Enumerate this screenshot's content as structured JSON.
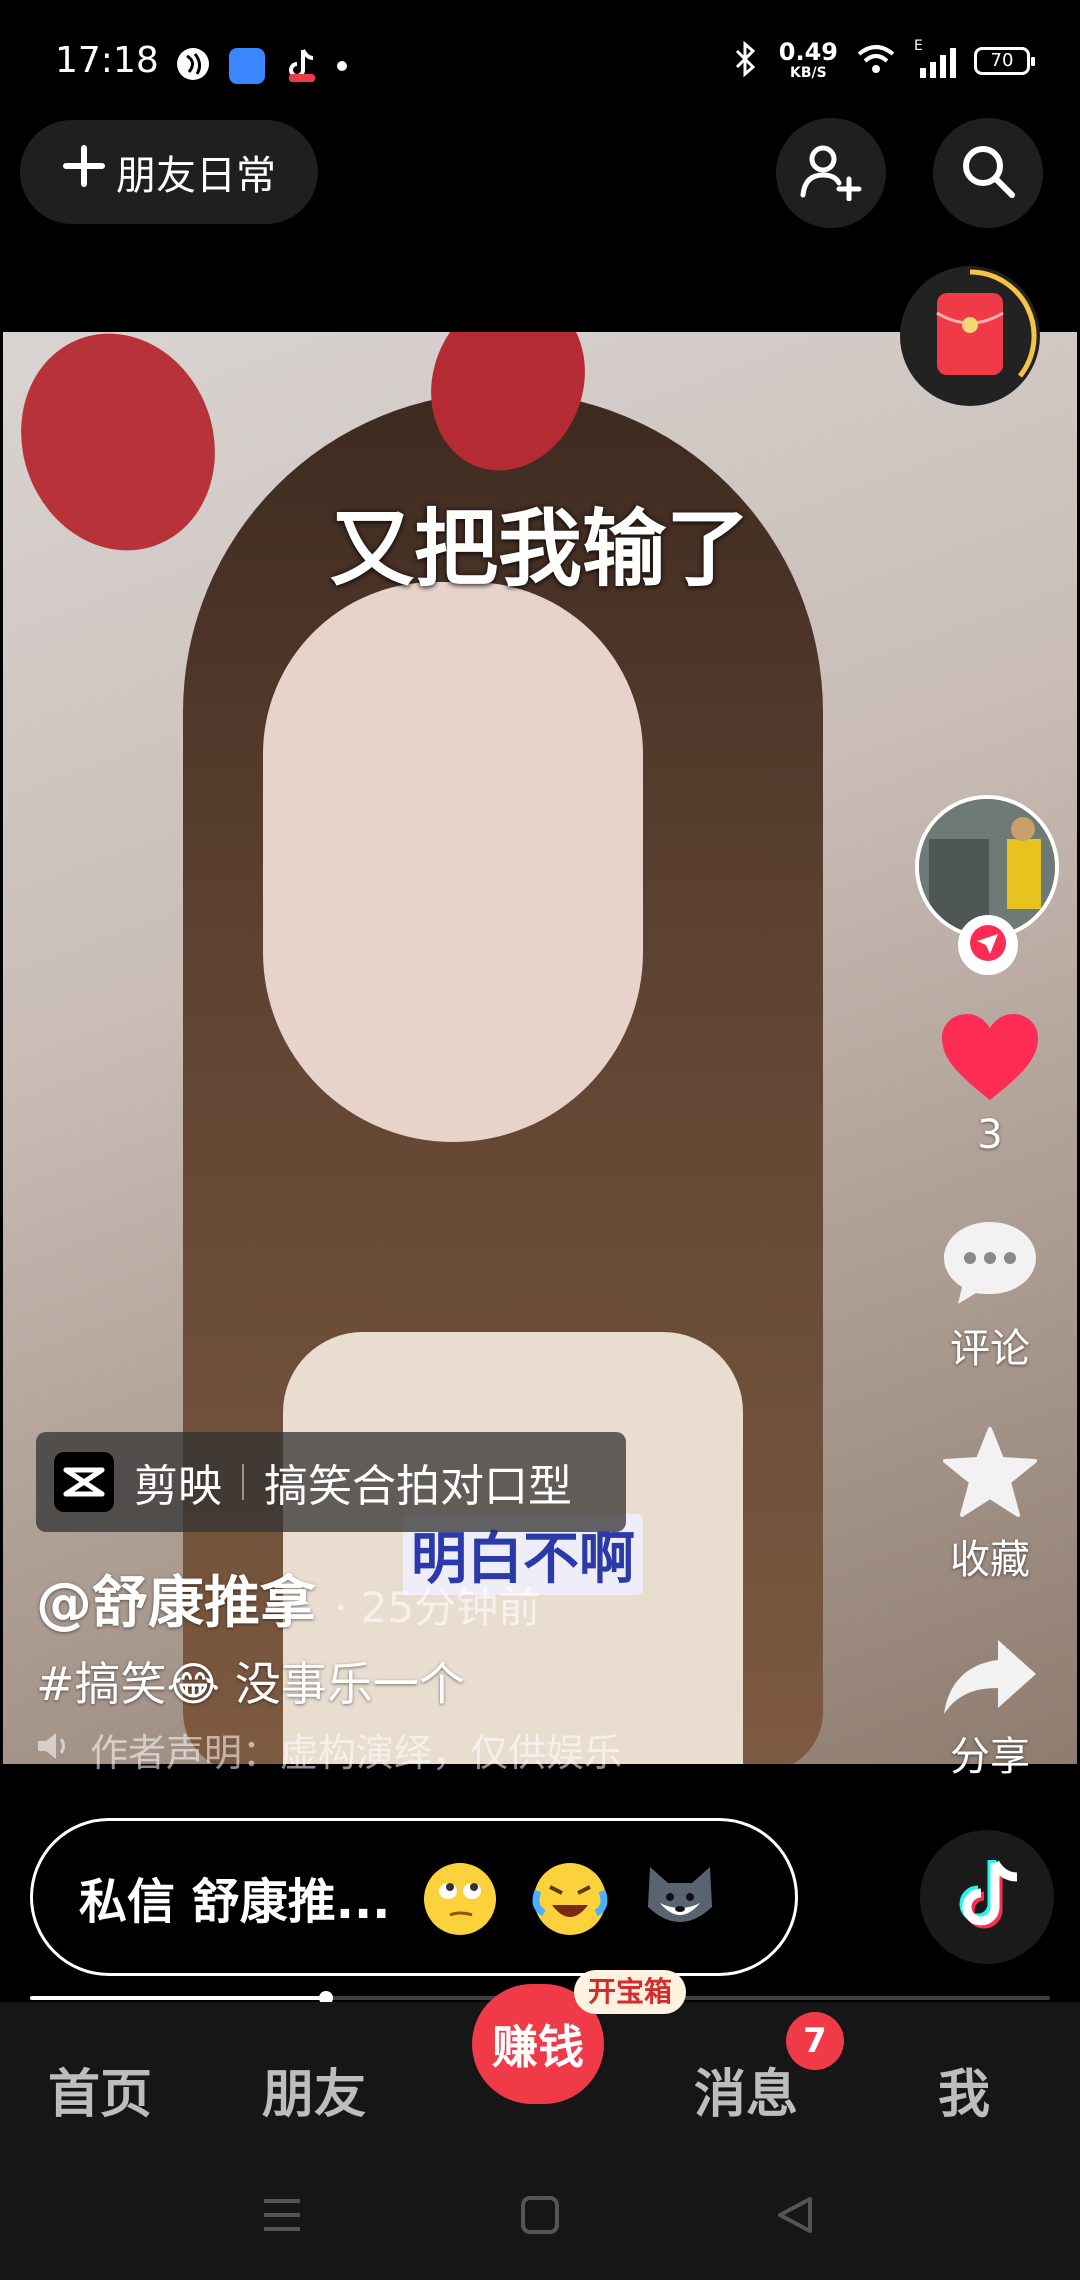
{
  "status_bar": {
    "time": "17:18",
    "net_speed_value": "0.49",
    "net_speed_unit": "KB/S",
    "network_type": "E",
    "battery": "70"
  },
  "top_bar": {
    "friends_daily_label": "朋友日常"
  },
  "video": {
    "caption_top": "又把我输了",
    "caption_bottom": "明白不啊",
    "app_tag": {
      "app_name": "剪映",
      "template_name": "搞笑合拍对口型"
    },
    "author": "@舒康推拿",
    "time_ago": "· 25分钟前",
    "description": "#搞笑😂 没事乐一个",
    "disclaimer": "作者声明：虚构演绎，仅供娱乐"
  },
  "right_rail": {
    "likes": "3",
    "comment_label": "评论",
    "favorite_label": "收藏",
    "share_label": "分享"
  },
  "message_bar": {
    "dm_text": "私信 舒康推...",
    "emojis": [
      "eye-roll-emoji",
      "laughing-crying-emoji",
      "wolf-emoji"
    ]
  },
  "progress": {
    "fraction": 0.29
  },
  "bottom_nav": {
    "home": "首页",
    "friends": "朋友",
    "earn": "赚钱",
    "chest_tag": "开宝箱",
    "messages": "消息",
    "messages_badge": "7",
    "me": "我"
  },
  "colors": {
    "like_red": "#fe2c55",
    "earn_red": "#f03a48",
    "dark_surface": "#1f1f1f"
  }
}
